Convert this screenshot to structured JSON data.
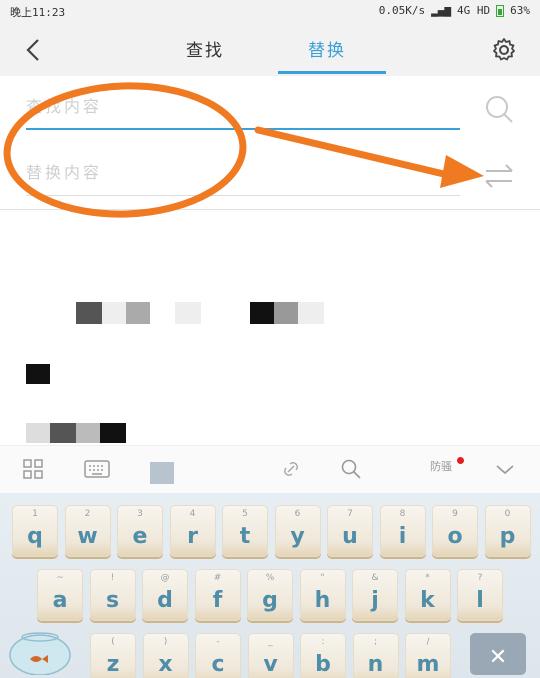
{
  "status_bar": {
    "time": "晚上11:23",
    "network_speed": "0.05K/s",
    "network_type": "4G HD",
    "battery": "63%"
  },
  "nav": {
    "tab_find": "查找",
    "tab_replace": "替换",
    "active_tab": "替换"
  },
  "form": {
    "find_placeholder": "查找内容",
    "replace_placeholder": "替换内容"
  },
  "keyboard_toolbar": {
    "badge_label": "防骚"
  },
  "keyboard": {
    "row1": [
      {
        "main": "q",
        "sub": "1"
      },
      {
        "main": "w",
        "sub": "2"
      },
      {
        "main": "e",
        "sub": "3"
      },
      {
        "main": "r",
        "sub": "4"
      },
      {
        "main": "t",
        "sub": "5"
      },
      {
        "main": "y",
        "sub": "6"
      },
      {
        "main": "u",
        "sub": "7"
      },
      {
        "main": "i",
        "sub": "8"
      },
      {
        "main": "o",
        "sub": "9"
      },
      {
        "main": "p",
        "sub": "0"
      }
    ],
    "row2": [
      {
        "main": "a",
        "sub": "~"
      },
      {
        "main": "s",
        "sub": "!"
      },
      {
        "main": "d",
        "sub": "@"
      },
      {
        "main": "f",
        "sub": "#"
      },
      {
        "main": "g",
        "sub": "%"
      },
      {
        "main": "h",
        "sub": "\""
      },
      {
        "main": "j",
        "sub": "&"
      },
      {
        "main": "k",
        "sub": "*"
      },
      {
        "main": "l",
        "sub": "?"
      }
    ],
    "row3": [
      {
        "main": "z",
        "sub": "("
      },
      {
        "main": "x",
        "sub": ")"
      },
      {
        "main": "c",
        "sub": "-"
      },
      {
        "main": "v",
        "sub": "_"
      },
      {
        "main": "b",
        "sub": ":"
      },
      {
        "main": "n",
        "sub": ";"
      },
      {
        "main": "m",
        "sub": "/"
      }
    ]
  },
  "colors": {
    "accent": "#3aa0d8",
    "annotation": "#f07a22",
    "key_text": "#4f8da8"
  }
}
